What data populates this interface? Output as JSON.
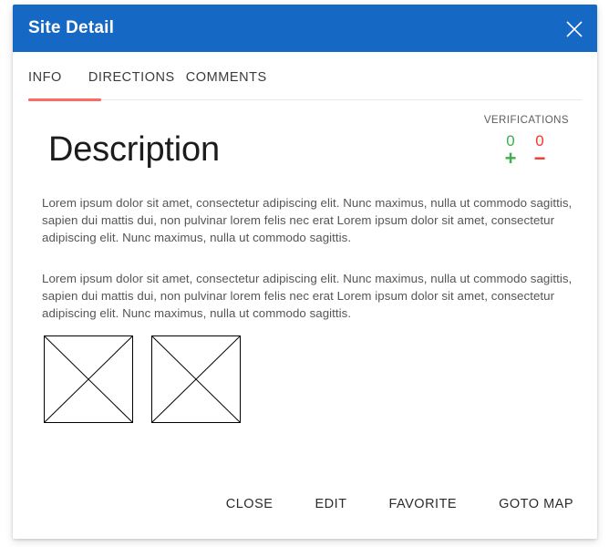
{
  "dialog": {
    "title": "Site Detail",
    "close_icon": "close-icon",
    "header_color": "#1668c5"
  },
  "tabs": {
    "items": [
      {
        "label": "INFO",
        "active": true
      },
      {
        "label": "DIRECTIONS",
        "active": false
      },
      {
        "label": "COMMENTS",
        "active": false
      }
    ],
    "active_indicator_color": "#fd6a61"
  },
  "verifications": {
    "label": "VERIFICATIONS",
    "up_count": "0",
    "down_count": "0",
    "up_sign": "+",
    "down_sign": "−",
    "up_color": "#3eae4e",
    "down_color": "#f0392b"
  },
  "info": {
    "heading": "Description",
    "paragraph_1": "Lorem ipsum dolor sit amet, consectetur adipiscing elit. Nunc maximus, nulla ut commodo sagittis, sapien dui mattis dui, non pulvinar lorem felis nec erat Lorem ipsum dolor sit amet, consectetur adipiscing elit. Nunc maximus, nulla ut commodo sagittis.",
    "paragraph_2": "Lorem ipsum dolor sit amet, consectetur adipiscing elit. Nunc maximus, nulla ut commodo sagittis, sapien dui mattis dui, non pulvinar lorem felis nec erat Lorem ipsum dolor sit amet, consectetur adipiscing elit. Nunc maximus, nulla ut commodo sagittis.",
    "thumbnails": [
      {
        "name": "image-placeholder-1"
      },
      {
        "name": "image-placeholder-2"
      }
    ]
  },
  "footer": {
    "actions": [
      {
        "label": "CLOSE"
      },
      {
        "label": "EDIT"
      },
      {
        "label": "FAVORITE"
      },
      {
        "label": "GOTO MAP"
      }
    ]
  }
}
